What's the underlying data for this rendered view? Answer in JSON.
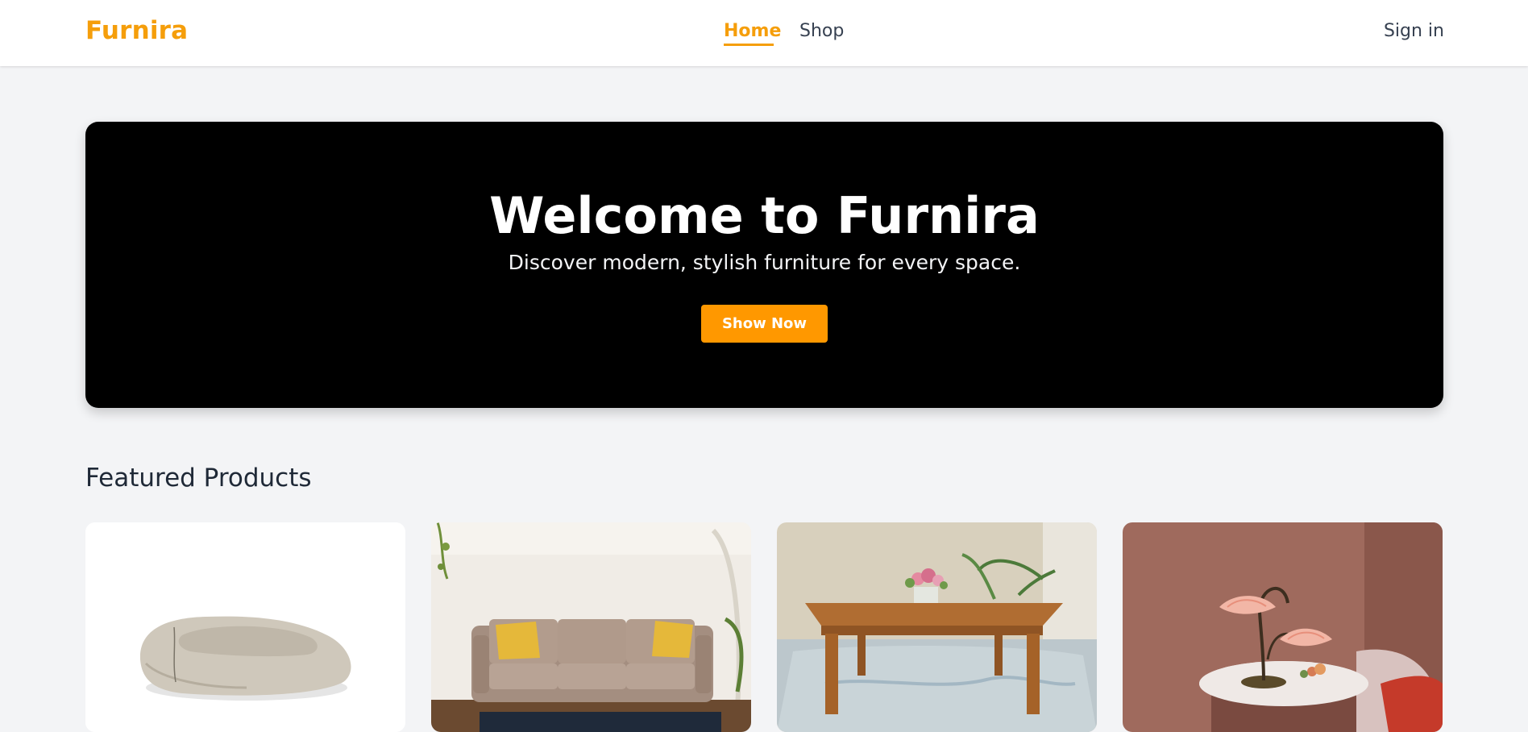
{
  "header": {
    "brand": "Furnira",
    "nav": {
      "home": "Home",
      "shop": "Shop"
    },
    "signin": "Sign in",
    "accent_color": "#f59e0b"
  },
  "hero": {
    "title": "Welcome to Furnira",
    "subtitle": "Discover modern, stylish furniture for every space.",
    "button": "Show Now",
    "button_color": "#ff9800"
  },
  "featured": {
    "title": "Featured Products",
    "products": [
      {
        "image": "bean-bag-chair"
      },
      {
        "image": "three-seat-sofa"
      },
      {
        "image": "wooden-table"
      },
      {
        "image": "flower-table-lamp"
      }
    ]
  }
}
